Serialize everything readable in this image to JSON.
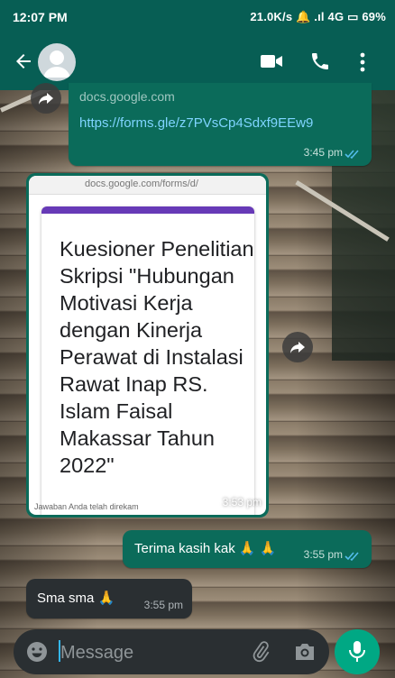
{
  "status_bar": {
    "time": "12:07 PM",
    "indicators": "21.0K/s 🔔 .ıl 4G ▭ 69%"
  },
  "toolbar": {
    "icons": [
      "back-arrow-icon",
      "avatar",
      "video-call-icon",
      "voice-call-icon",
      "more-vert-icon"
    ]
  },
  "messages": [
    {
      "type": "link",
      "direction": "outgoing",
      "domain": "docs.google.com",
      "link": "https://forms.gle/z7PVsCp4Sdxf9EEw9",
      "time": "3:45 pm"
    },
    {
      "type": "image",
      "direction": "incoming",
      "url_bar": "docs.google.com/forms/d/",
      "form_title": "Kuesioner Penelitian Skripsi \"Hubungan Motivasi Kerja dengan Kinerja Perawat di Instalasi Rawat Inap RS. Islam Faisal Makassar Tahun 2022\"",
      "footer": "Jawaban Anda telah direkam",
      "time": "3:53 pm"
    },
    {
      "type": "text",
      "direction": "outgoing",
      "text": "Terima kasih kak 🙏 🙏",
      "time": "3:55 pm"
    },
    {
      "type": "text",
      "direction": "incoming",
      "text": "Sma sma 🙏",
      "time": "3:55 pm"
    }
  ],
  "composer": {
    "placeholder": "Message"
  },
  "colors": {
    "header": "#075e54",
    "outgoing_bubble": "#0b6b5a",
    "incoming_bubble": "#2a2f32",
    "mic_button": "#00a884",
    "form_accent": "#673ab7",
    "read_ticks": "#53bdeb"
  }
}
